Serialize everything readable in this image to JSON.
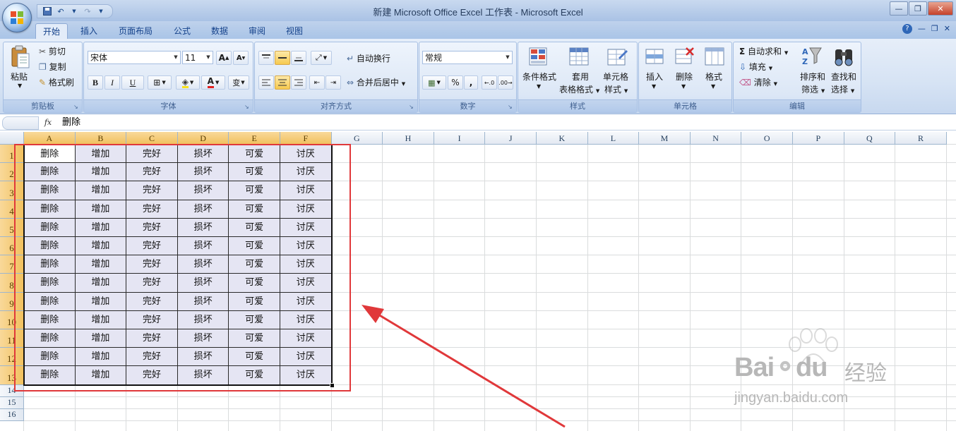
{
  "window": {
    "title": "新建 Microsoft Office Excel 工作表 - Microsoft Excel",
    "controls": [
      "minimize",
      "restore",
      "close"
    ]
  },
  "ribbon_tabs": [
    {
      "label": "开始",
      "active": true
    },
    {
      "label": "插入"
    },
    {
      "label": "页面布局"
    },
    {
      "label": "公式"
    },
    {
      "label": "数据"
    },
    {
      "label": "审阅"
    },
    {
      "label": "视图"
    }
  ],
  "clipboard": {
    "paste": "粘贴",
    "cut": "剪切",
    "copy": "复制",
    "format_painter": "格式刷",
    "group": "剪贴板"
  },
  "font": {
    "name": "宋体",
    "size": "11",
    "bold": "B",
    "italic": "I",
    "underline": "U",
    "group": "字体"
  },
  "alignment": {
    "wrap_text": "自动换行",
    "merge_center": "合并后居中",
    "group": "对齐方式"
  },
  "number": {
    "format": "常规",
    "percent": "%",
    "comma": ",",
    "group": "数字"
  },
  "styles": {
    "conditional_a": "条件格式",
    "table_a": "套用",
    "table_b": "表格格式",
    "cell_a": "单元格",
    "cell_b": "样式",
    "group": "样式"
  },
  "cells": {
    "insert": "插入",
    "delete": "删除",
    "format": "格式",
    "group": "单元格"
  },
  "editing": {
    "autosum": "自动求和",
    "fill": "填充",
    "clear": "清除",
    "sort_a": "排序和",
    "sort_b": "筛选",
    "find_a": "查找和",
    "find_b": "选择",
    "group": "编辑"
  },
  "formula_bar": {
    "fx": "fx",
    "content": "删除"
  },
  "sheet": {
    "columns": [
      "A",
      "B",
      "C",
      "D",
      "E",
      "F",
      "G",
      "H",
      "I",
      "J",
      "K",
      "L",
      "M",
      "N",
      "O",
      "P",
      "Q",
      "R"
    ],
    "selected_columns": [
      "A",
      "B",
      "C",
      "D",
      "E",
      "F"
    ],
    "rows": [
      "1",
      "2",
      "3",
      "4",
      "5",
      "6",
      "7",
      "8",
      "9",
      "10",
      "11",
      "12",
      "13",
      "14",
      "15",
      "16"
    ],
    "selected_rows_count": 13,
    "row_values": [
      "删除",
      "增加",
      "完好",
      "损坏",
      "可爱",
      "讨厌"
    ]
  },
  "watermark": {
    "brand_a": "Bai",
    "brand_b": "du",
    "brand_cn": "经验",
    "url": "jingyan.baidu.com"
  },
  "colors": {
    "annotation": "#e0383a",
    "selection_fill": "#e5e5f3",
    "selected_header": "#f1c15f",
    "ribbon": "#dce7f6"
  }
}
